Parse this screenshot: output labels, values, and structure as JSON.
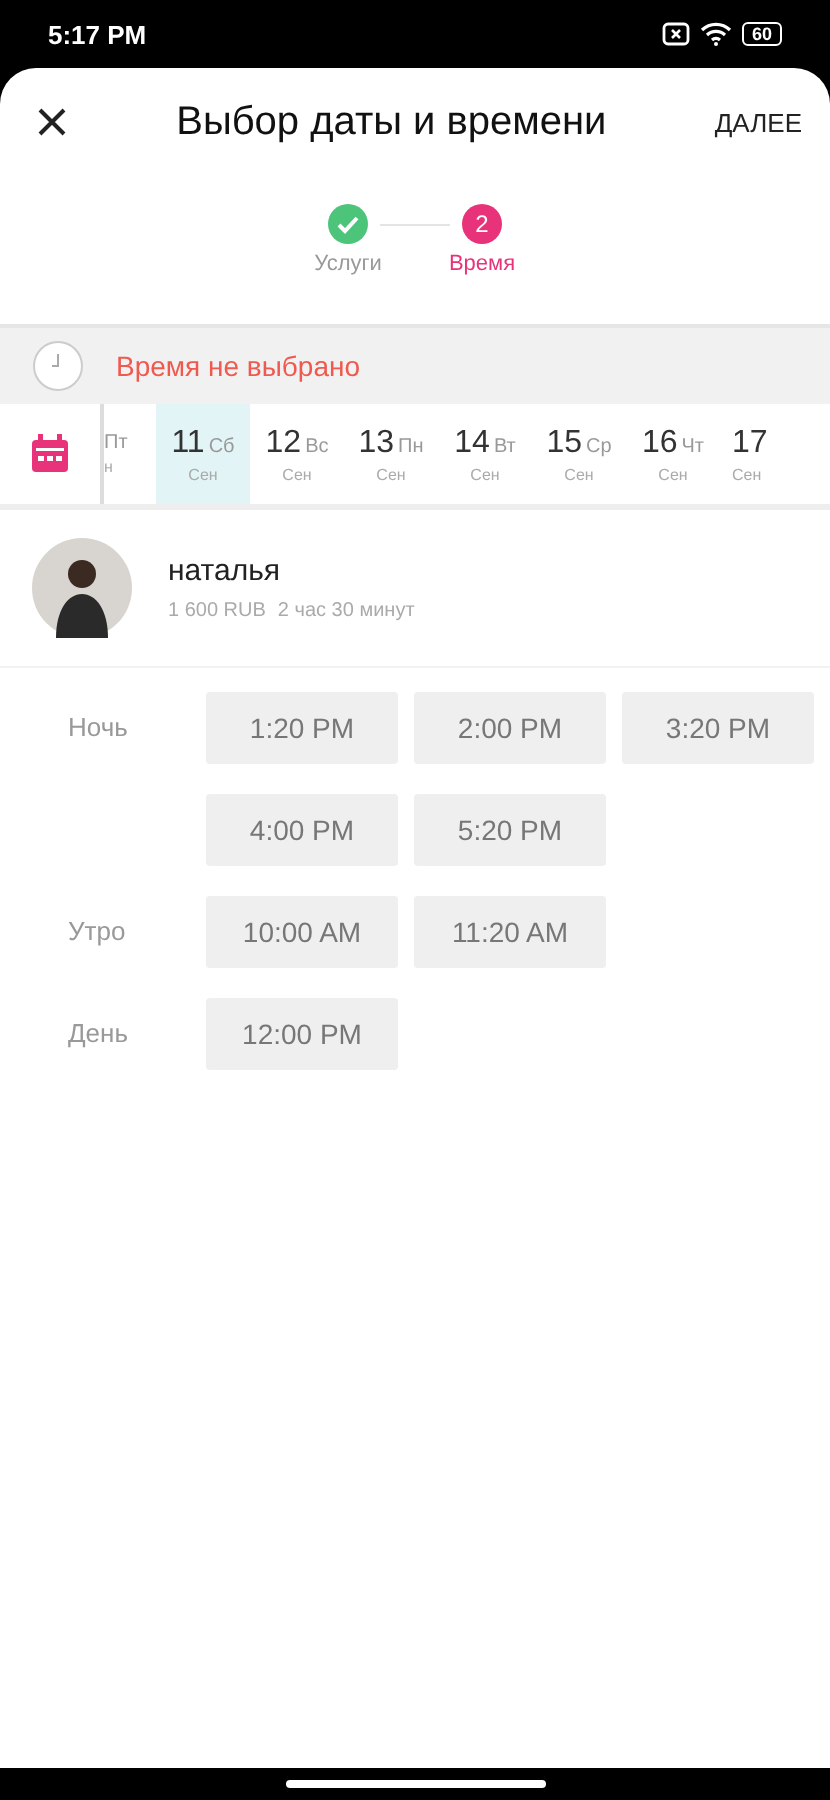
{
  "status_bar": {
    "time": "5:17 PM",
    "battery": "60"
  },
  "header": {
    "title": "Выбор даты и времени",
    "action": "ДАЛЕЕ"
  },
  "steps": [
    {
      "label": "Услуги",
      "kind": "done"
    },
    {
      "label": "Время",
      "number": "2",
      "kind": "current"
    }
  ],
  "alert": {
    "text": "Время не выбрано"
  },
  "days": [
    {
      "weekday": "Пт",
      "month": "н",
      "selected": false
    },
    {
      "number": "11",
      "weekday": "Сб",
      "month": "Сен",
      "selected": true
    },
    {
      "number": "12",
      "weekday": "Вс",
      "month": "Сен",
      "selected": false
    },
    {
      "number": "13",
      "weekday": "Пн",
      "month": "Сен",
      "selected": false
    },
    {
      "number": "14",
      "weekday": "Вт",
      "month": "Сен",
      "selected": false
    },
    {
      "number": "15",
      "weekday": "Ср",
      "month": "Сен",
      "selected": false
    },
    {
      "number": "16",
      "weekday": "Чт",
      "month": "Сен",
      "selected": false
    },
    {
      "number": "17",
      "month": "Сен",
      "selected": false
    }
  ],
  "master": {
    "name": "наталья",
    "price": "1 600 RUB",
    "duration": "2 час 30 минут"
  },
  "slot_groups": [
    {
      "label": "Ночь",
      "slots": [
        "1:20 PM",
        "2:00 PM",
        "3:20 PM",
        "4:00 PM",
        "5:20 PM"
      ]
    },
    {
      "label": "Утро",
      "slots": [
        "10:00 AM",
        "11:20 AM"
      ]
    },
    {
      "label": "День",
      "slots": [
        "12:00 PM"
      ]
    }
  ]
}
